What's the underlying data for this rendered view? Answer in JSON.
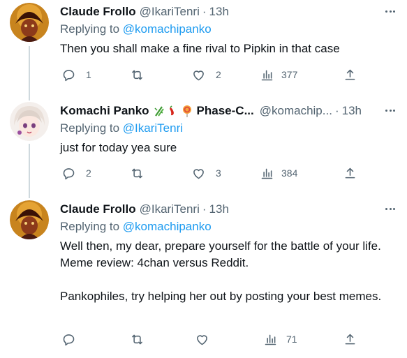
{
  "tweets": [
    {
      "name": "Claude Frollo",
      "handle": "@IkariTenri",
      "dot": "·",
      "time": "13h",
      "replying_prefix": "Replying to ",
      "replying_to": "@komachipanko",
      "text": [
        "Then you shall make a fine rival to Pipkin in that case"
      ],
      "counts": {
        "reply": "1",
        "retweet": "",
        "like": "2",
        "views": "377"
      }
    },
    {
      "name": "Komachi Panko",
      "name_suffix": "Phase-C...",
      "handle": "@komachip...",
      "dot": "·",
      "time": "13h",
      "replying_prefix": "Replying to ",
      "replying_to": "@IkariTenri",
      "text": [
        "just for today yea sure"
      ],
      "counts": {
        "reply": "2",
        "retweet": "",
        "like": "3",
        "views": "384"
      }
    },
    {
      "name": "Claude Frollo",
      "handle": "@IkariTenri",
      "dot": "·",
      "time": "13h",
      "replying_prefix": "Replying to ",
      "replying_to": "@komachipanko",
      "text": [
        "Well then, my dear, prepare yourself for the battle of your life. Meme review: 4chan versus Reddit.",
        "Pankophiles, try helping her out by posting your best memes."
      ],
      "counts": {
        "reply": "",
        "retweet": "",
        "like": "",
        "views": "71"
      }
    }
  ],
  "icons": [
    "reply-icon",
    "retweet-icon",
    "like-icon",
    "views-icon",
    "share-icon",
    "more-icon",
    "bamboo-emoji-icon",
    "lollipop-emoji-icon"
  ],
  "colors": {
    "link": "#1d9bf0",
    "secondary": "#536471",
    "text": "#0f1419",
    "thread_line": "#cfd9de"
  }
}
